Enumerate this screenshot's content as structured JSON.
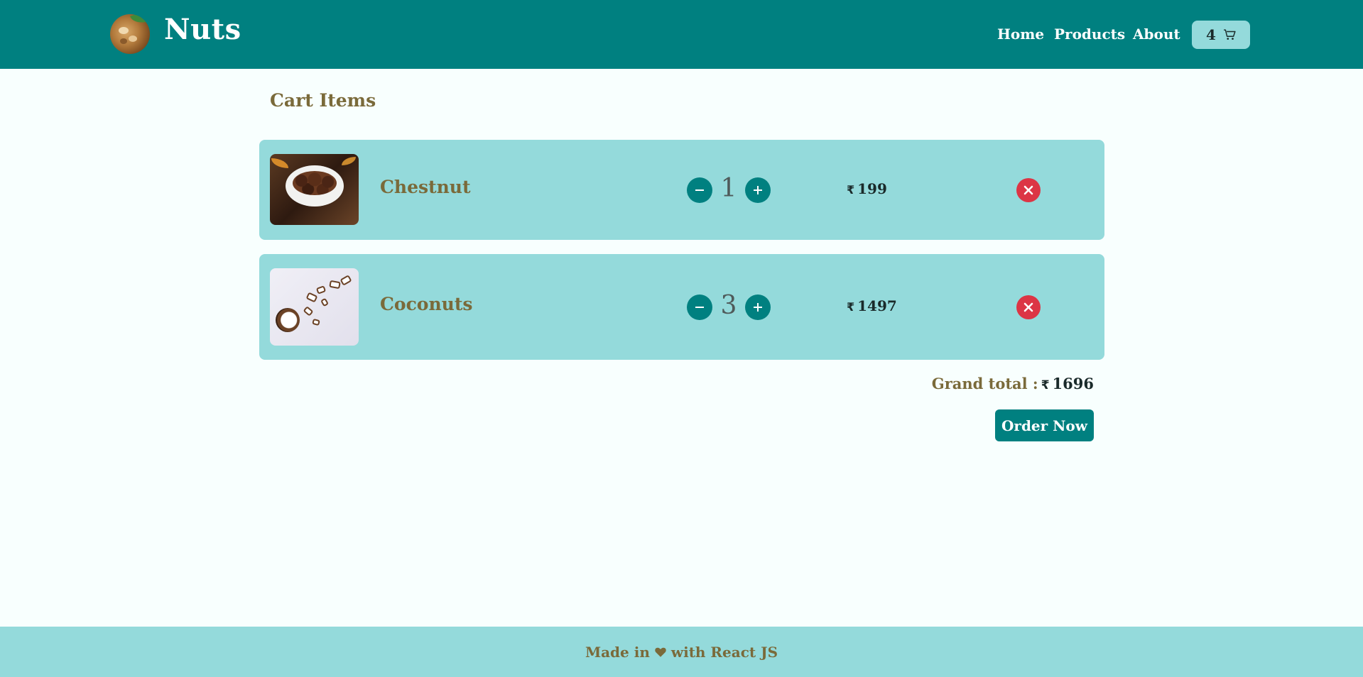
{
  "header": {
    "brand": "Nuts",
    "nav": [
      {
        "label": "Home"
      },
      {
        "label": "Products"
      },
      {
        "label": "About"
      }
    ],
    "cart_count": "4",
    "accent_color": "#008080",
    "light_color": "#94dadb"
  },
  "cart": {
    "title": "Cart Items",
    "currency_symbol": "₹",
    "items": [
      {
        "name": "Chestnut",
        "quantity": "1",
        "price": "199",
        "image": "chestnut-bowl-image"
      },
      {
        "name": "Coconuts",
        "quantity": "3",
        "price": "1497",
        "image": "coconut-pieces-image"
      }
    ],
    "decrement_icon": "minus-icon",
    "increment_icon": "plus-icon",
    "remove_icon": "close-circle-icon",
    "grand_total_label": "Grand total :",
    "grand_total": "1696",
    "order_button": "Order Now"
  },
  "footer": {
    "text_before": "Made in",
    "icon": "heart-icon",
    "text_after": "with React JS"
  }
}
